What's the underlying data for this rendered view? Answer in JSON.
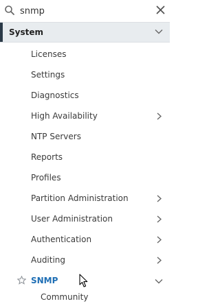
{
  "search": {
    "value": "snmp",
    "icon": "search-icon",
    "clear_icon": "close-icon"
  },
  "section": {
    "label": "System",
    "expanded": true,
    "accent_color": "#2b3a48",
    "background_color": "#e8ecef"
  },
  "nav_items": [
    {
      "label": "Licenses",
      "has_submenu": false
    },
    {
      "label": "Settings",
      "has_submenu": false
    },
    {
      "label": "Diagnostics",
      "has_submenu": false
    },
    {
      "label": "High Availability",
      "has_submenu": true
    },
    {
      "label": "NTP Servers",
      "has_submenu": false
    },
    {
      "label": "Reports",
      "has_submenu": false
    },
    {
      "label": "Profiles",
      "has_submenu": false
    },
    {
      "label": "Partition Administration",
      "has_submenu": true
    },
    {
      "label": "User Administration",
      "has_submenu": true
    },
    {
      "label": "Authentication",
      "has_submenu": true
    },
    {
      "label": "Auditing",
      "has_submenu": true
    }
  ],
  "active_item": {
    "label": "SNMP",
    "favorite_icon": "star-icon",
    "expanded": true,
    "color": "#1f6fb5"
  },
  "sub_items": [
    {
      "label": "Community"
    }
  ]
}
